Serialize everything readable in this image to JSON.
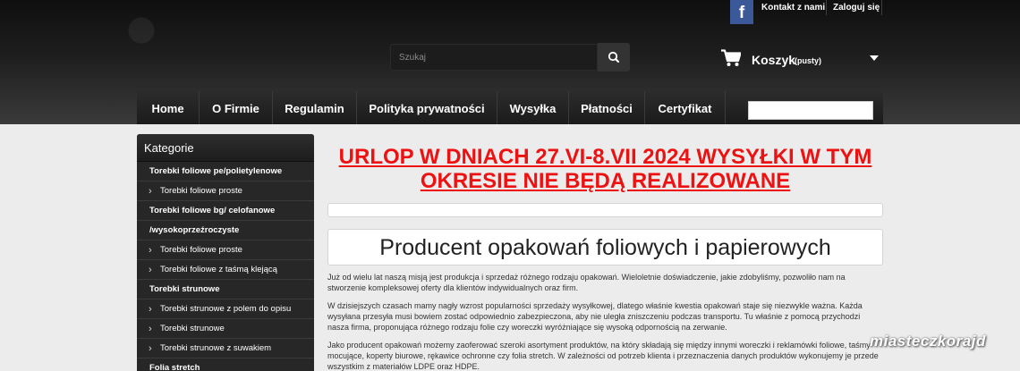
{
  "header": {
    "facebook_label": "f",
    "contact_label": "Kontakt z nami",
    "login_label": "Zaloguj się",
    "search": {
      "placeholder": "Szukaj",
      "value": ""
    },
    "cart": {
      "label": "Koszyk",
      "status": "(pusty)"
    }
  },
  "menu": {
    "items": [
      "Home",
      "O Firmie",
      "Regulamin",
      "Polityka prywatności",
      "Wysyłka",
      "Płatności",
      "Certyfikat"
    ]
  },
  "sidebar": {
    "title": "Kategorie",
    "categories": [
      {
        "label": "Torebki foliowe pe/polietylenowe",
        "level": "main"
      },
      {
        "label": "Torebki foliowe proste",
        "level": "sub"
      },
      {
        "label": "Torebki foliowe bg/ celofanowe",
        "level": "main"
      },
      {
        "label": "/wysokoprzeźroczyste",
        "level": "main"
      },
      {
        "label": "Torebki foliowe proste",
        "level": "sub"
      },
      {
        "label": "Torebki foliowe z taśmą klejącą",
        "level": "sub"
      },
      {
        "label": "Torebki strunowe",
        "level": "main"
      },
      {
        "label": "Torebki strunowe z polem do opisu",
        "level": "sub"
      },
      {
        "label": "Torebki strunowe",
        "level": "sub"
      },
      {
        "label": "Torebki strunowe z suwakiem",
        "level": "sub"
      },
      {
        "label": "Folia stretch",
        "level": "main"
      }
    ]
  },
  "main": {
    "notice": "URLOP W DNIACH 27.VI-8.VII 2024 WYSYŁKI W TYM OKRESIE NIE BĘDĄ REALIZOWANE",
    "heading": "Producent opakowań foliowych i papierowych",
    "paragraphs": [
      "Już od wielu lat naszą misją jest produkcja i sprzedaż różnego rodzaju opakowań. Wieloletnie doświadczenie, jakie zdobyliśmy, pozwoliło nam na stworzenie kompleksowej oferty dla klientów indywidualnych oraz firm.",
      "W dzisiejszych czasach mamy nagły wzrost popularności sprzedaży wysyłkowej, dlatego właśnie kwestia opakowań staje się niezwykle ważna. Każda wysyłana przesyła musi bowiem zostać odpowiednio zabezpieczona, aby nie uległa zniszczeniu podczas transportu. Tu właśnie z pomocą przychodzi nasza firma, proponująca różnego rodzaju folie czy woreczki wyróżniające się wysoką odpornością na zerwanie.",
      "Jako producent opakowań możemy zaoferować szeroki asortyment produktów, na który składają się między innymi woreczki i reklamówki foliowe, taśmy mocujące, koperty biurowe, rękawice ochronne czy folia stretch. W zależności od potrzeb klienta i przeznaczenia danych produktów wykonujemy je przede wszystkim z materiałów LDPE oraz HDPE."
    ]
  },
  "watermark": "miasteczkorajd",
  "colors": {
    "notice": "#ee1111",
    "header_bg": "#1e1e1e",
    "sidebar_bg": "#272727",
    "page_bg": "#ececec",
    "facebook": "#3b5998"
  }
}
